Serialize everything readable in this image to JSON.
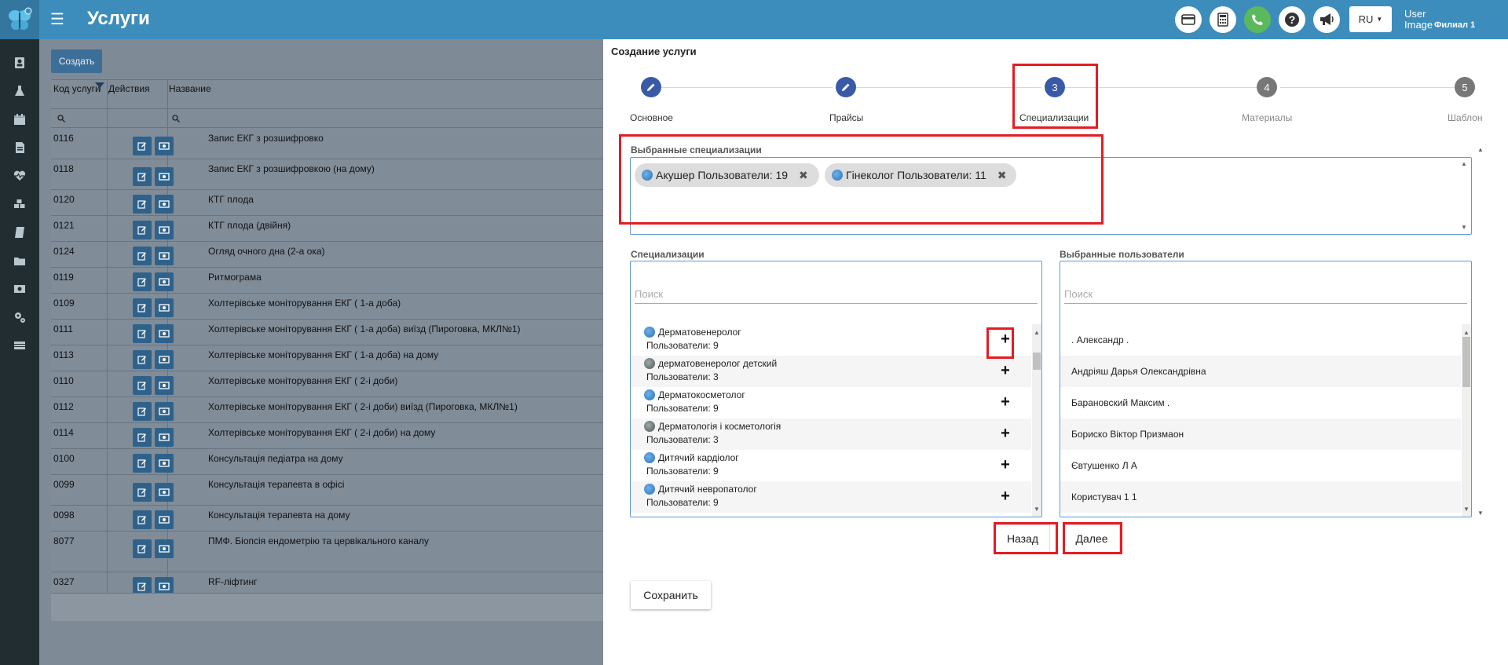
{
  "header": {
    "title": "Услуги",
    "language": "RU",
    "user_image_alt": "User Image",
    "branch": "Филиал 1"
  },
  "colors": {
    "topbar": "#3c8dbc",
    "sidebar": "#222d32",
    "accent": "#3a5aa8",
    "highlight": "#e51c23"
  },
  "list": {
    "create_label": "Создать",
    "columns": [
      "Код услуги",
      "Действия",
      "Название"
    ],
    "rows": [
      {
        "code": "0116",
        "name": "Запис ЕКГ з розшифровко"
      },
      {
        "code": "0118",
        "name": "Запис ЕКГ з розшифровкою (на дому)"
      },
      {
        "code": "0120",
        "name": "КТГ плода"
      },
      {
        "code": "0121",
        "name": "КТГ плода (двійня)"
      },
      {
        "code": "0124",
        "name": "Огляд очного дна (2-а ока)"
      },
      {
        "code": "0119",
        "name": "Ритмограма"
      },
      {
        "code": "0109",
        "name": "Холтерівське моніторування ЕКГ ( 1-а доба)"
      },
      {
        "code": "0111",
        "name": "Холтерівське моніторування ЕКГ ( 1-а доба) виїзд (Пироговка, МКЛ№1)"
      },
      {
        "code": "0113",
        "name": "Холтерівське моніторування ЕКГ ( 1-а доба) на дому"
      },
      {
        "code": "0110",
        "name": "Холтерівське моніторування ЕКГ ( 2-і доби)"
      },
      {
        "code": "0112",
        "name": "Холтерівське моніторування ЕКГ ( 2-і доби) виїзд (Пироговка, МКЛ№1)"
      },
      {
        "code": "0114",
        "name": "Холтерівське моніторування ЕКГ ( 2-і доби) на дому"
      },
      {
        "code": "0100",
        "name": "Консультація педіатра на дому"
      },
      {
        "code": "0099",
        "name": "Консультація терапевта в офісі"
      },
      {
        "code": "0098",
        "name": "Консультація терапевта на дому"
      },
      {
        "code": "8077",
        "name": "ПМФ. Біопсія ендометрію та цервікального каналу"
      },
      {
        "code": "0327",
        "name": "RF-ліфтинг"
      }
    ]
  },
  "modal": {
    "title": "Создание услуги",
    "steps": [
      {
        "label": "Основное",
        "state": "done",
        "icon": "pencil-icon"
      },
      {
        "label": "Прайсы",
        "state": "done",
        "icon": "pencil-icon"
      },
      {
        "label": "Специализации",
        "state": "active",
        "number": "3"
      },
      {
        "label": "Материалы",
        "state": "pending",
        "number": "4"
      },
      {
        "label": "Шаблон",
        "state": "pending",
        "number": "5"
      }
    ],
    "selected_specializations_label": "Выбранные специализации",
    "chips": [
      "Акушер Пользователи: 19",
      "Гінеколог Пользователи: 11"
    ],
    "specializations_label": "Специализации",
    "selected_users_label": "Выбранные пользователи",
    "search_placeholder": "Поиск",
    "specializations": [
      {
        "name": "Дерматовенеролог",
        "users": "Пользователи: 9",
        "globe": "blue"
      },
      {
        "name": "дерматовенеролог детский",
        "users": "Пользователи: 3",
        "globe": "gray"
      },
      {
        "name": "Дерматокосметолог",
        "users": "Пользователи: 9",
        "globe": "blue"
      },
      {
        "name": "Дерматологія і косметологія",
        "users": "Пользователи: 3",
        "globe": "gray"
      },
      {
        "name": "Дитячий кардіолог",
        "users": "Пользователи: 9",
        "globe": "blue"
      },
      {
        "name": "Дитячий невропатолог",
        "users": "Пользователи: 9",
        "globe": "blue"
      }
    ],
    "users": [
      ". Александр .",
      "Андріяш Дарья Олександрівна",
      "Барановский Максим .",
      "Бориско Віктор Призмаон",
      "Євтушенко Л А",
      "Користувач 1 1"
    ],
    "back_label": "Назад",
    "next_label": "Далее",
    "save_label": "Сохранить"
  }
}
